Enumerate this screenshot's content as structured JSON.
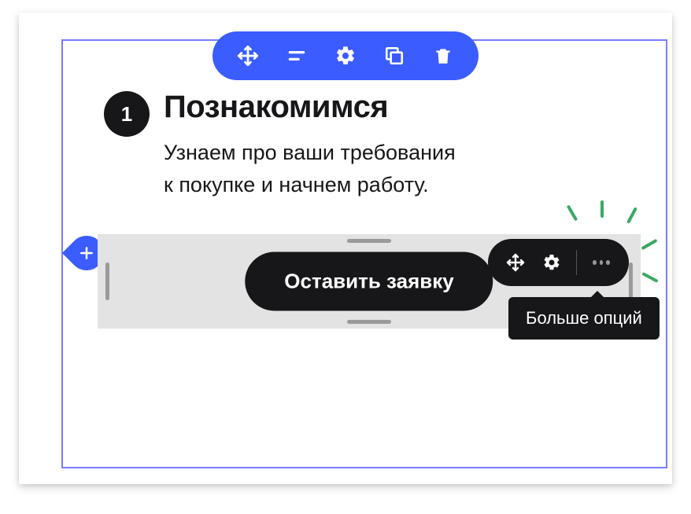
{
  "step": {
    "number": "1",
    "title": "Познакомимся",
    "description_line1": "Узнаем про ваши требования",
    "description_line2": "к покупке и начнем работу."
  },
  "cta": {
    "label": "Оставить заявку"
  },
  "tooltip": {
    "text": "Больше опций"
  },
  "icons": {
    "move": "move-icon",
    "align": "align-icon",
    "settings": "gear-icon",
    "copy": "copy-icon",
    "delete": "trash-icon",
    "add": "plus-icon",
    "more": "more-icon"
  }
}
